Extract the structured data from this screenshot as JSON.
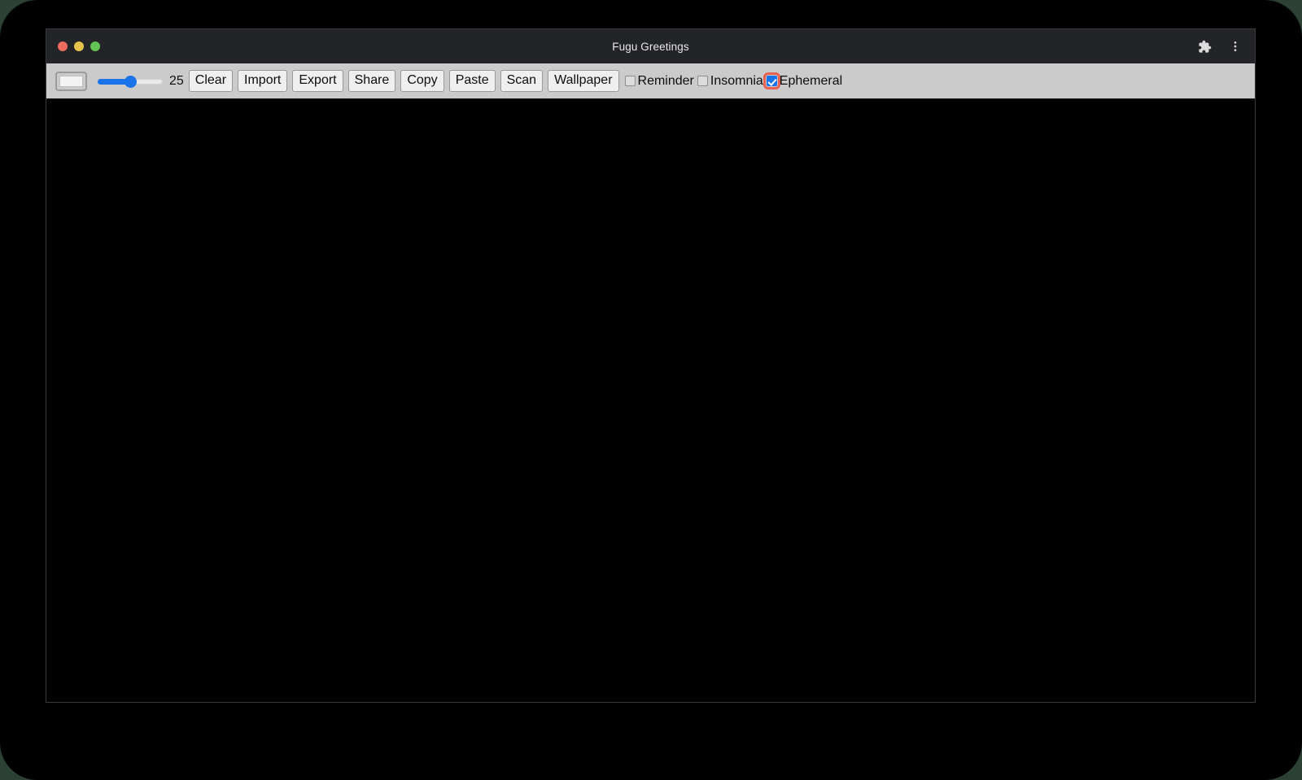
{
  "window": {
    "title": "Fugu Greetings",
    "traffic_lights": [
      {
        "name": "close",
        "color": "#ed6a5e"
      },
      {
        "name": "minimize",
        "color": "#e6c14c"
      },
      {
        "name": "maximize",
        "color": "#61c454"
      }
    ],
    "actions": [
      {
        "name": "extensions-icon",
        "label": "Extensions"
      },
      {
        "name": "more-menu-icon",
        "label": "More options"
      }
    ]
  },
  "toolbar": {
    "color_input": {
      "name": "pen-color-input",
      "value": "#f3f3f3"
    },
    "slider": {
      "name": "pen-size-slider",
      "value": "25",
      "min": "1",
      "max": "50",
      "percent": 52
    },
    "buttons": [
      {
        "id": "clear",
        "label": "Clear"
      },
      {
        "id": "import",
        "label": "Import"
      },
      {
        "id": "export",
        "label": "Export"
      },
      {
        "id": "share",
        "label": "Share"
      },
      {
        "id": "copy",
        "label": "Copy"
      },
      {
        "id": "paste",
        "label": "Paste"
      },
      {
        "id": "scan",
        "label": "Scan"
      },
      {
        "id": "wallpaper",
        "label": "Wallpaper"
      }
    ],
    "checkboxes": [
      {
        "id": "reminder",
        "label": "Reminder",
        "checked": false,
        "focused": false
      },
      {
        "id": "insomnia",
        "label": "Insomnia",
        "checked": false,
        "focused": false
      },
      {
        "id": "ephemeral",
        "label": "Ephemeral",
        "checked": true,
        "focused": true
      }
    ]
  },
  "canvas": {
    "name": "drawing-canvas",
    "background": "#000000"
  },
  "colors": {
    "accent": "#1a73e8",
    "focus_ring": "#e8604f",
    "toolbar_bg": "#cbcbcb",
    "titlebar_bg": "#232427",
    "desktop_bg": "#2d4034"
  }
}
